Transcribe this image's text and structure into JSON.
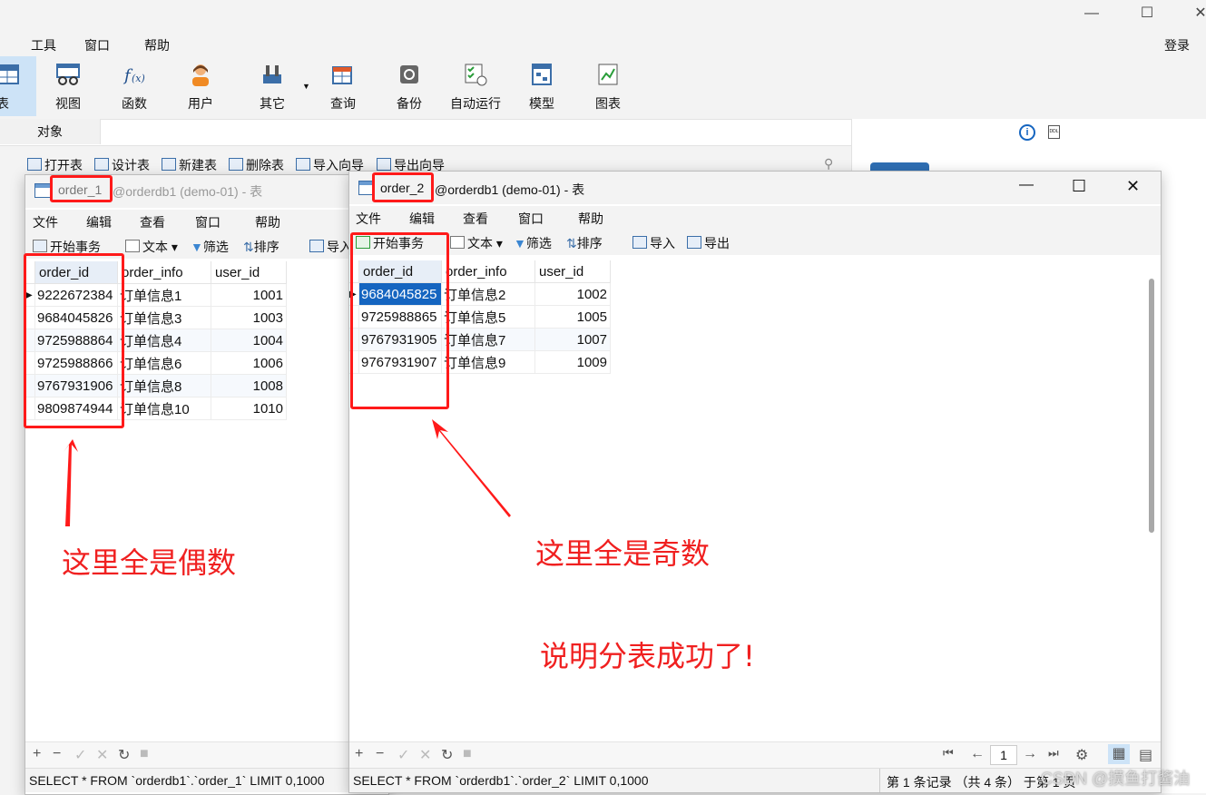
{
  "main": {
    "menu": [
      "工具",
      "窗口",
      "帮助"
    ],
    "login": "登录",
    "toolbar": [
      "表",
      "视图",
      "函数",
      "用户",
      "其它",
      "查询",
      "备份",
      "自动运行",
      "模型",
      "图表"
    ],
    "object_tab": "对象",
    "object_tools": [
      "打开表",
      "设计表",
      "新建表",
      "删除表",
      "导入向导",
      "导出向导"
    ]
  },
  "window1": {
    "title_table": "order_1",
    "title_rest": "@orderdb1 (demo-01) - 表",
    "menu": [
      "文件",
      "编辑",
      "查看",
      "窗口",
      "帮助"
    ],
    "tools": [
      "开始事务",
      "文本",
      "筛选",
      "排序",
      "导入"
    ],
    "columns": [
      "order_id",
      "order_info",
      "user_id"
    ],
    "rows": [
      [
        "9222672384",
        "订单信息1",
        "1001"
      ],
      [
        "9684045826",
        "订单信息3",
        "1003"
      ],
      [
        "9725988864",
        "订单信息4",
        "1004"
      ],
      [
        "9725988866",
        "订单信息6",
        "1006"
      ],
      [
        "9767931906",
        "订单信息8",
        "1008"
      ],
      [
        "9809874944",
        "订单信息10",
        "1010"
      ]
    ],
    "sql": "SELECT * FROM `orderdb1`.`order_1` LIMIT 0,1000"
  },
  "window2": {
    "title_table": "order_2",
    "title_rest": "@orderdb1 (demo-01) - 表",
    "menu": [
      "文件",
      "编辑",
      "查看",
      "窗口",
      "帮助"
    ],
    "tools": [
      "开始事务",
      "文本",
      "筛选",
      "排序",
      "导入",
      "导出"
    ],
    "columns": [
      "order_id",
      "order_info",
      "user_id"
    ],
    "rows": [
      [
        "9684045825",
        "订单信息2",
        "1002"
      ],
      [
        "9725988865",
        "订单信息5",
        "1005"
      ],
      [
        "9767931905",
        "订单信息7",
        "1007"
      ],
      [
        "9767931907",
        "订单信息9",
        "1009"
      ]
    ],
    "page": "1",
    "sql": "SELECT * FROM `orderdb1`.`order_2` LIMIT 0,1000",
    "record_info": "第 1 条记录 （共 4 条） 于第 1 页"
  },
  "annotations": {
    "even": "这里全是偶数",
    "odd": "这里全是奇数",
    "success": "说明分表成功了!"
  },
  "watermark": "CSDN @摸鱼打酱油",
  "colors": {
    "annotation": "#ff1a1a",
    "selection": "#1565c0"
  }
}
